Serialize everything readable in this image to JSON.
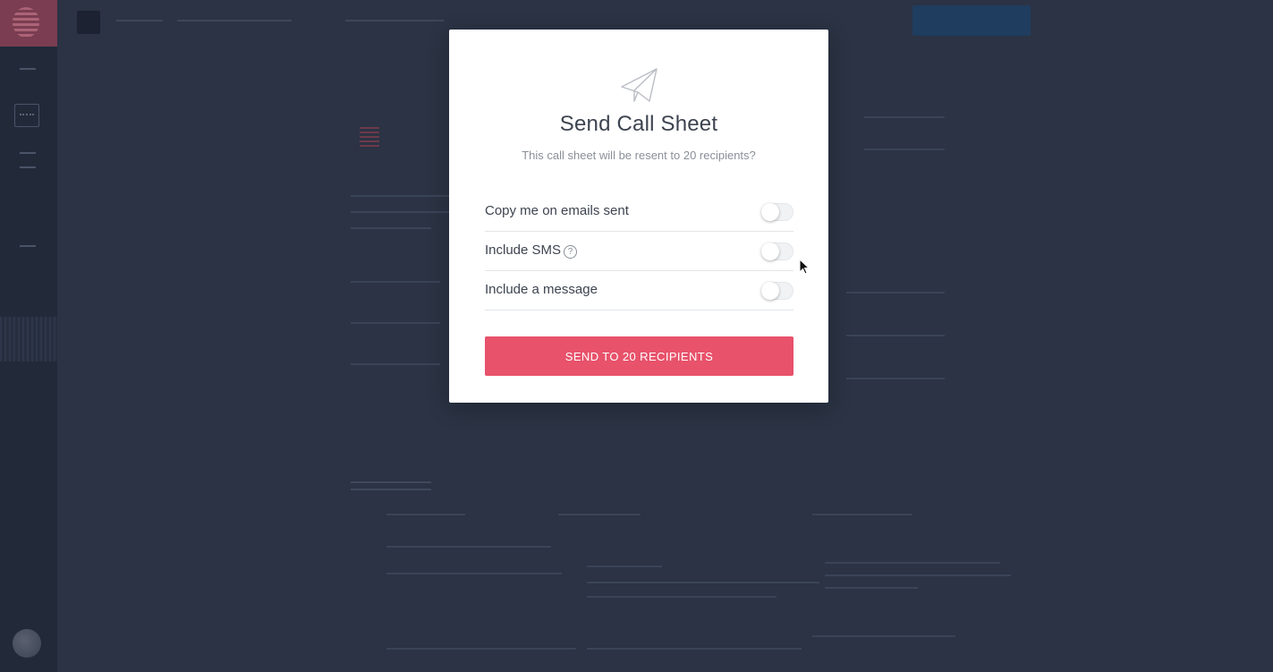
{
  "modal": {
    "icon": "paper-plane-icon",
    "title": "Send Call Sheet",
    "subtitle": "This call sheet will be resent to 20 recipients?",
    "options": [
      {
        "label": "Copy me on emails sent",
        "enabled": false
      },
      {
        "label": "Include SMS",
        "enabled": false,
        "help_icon": "question-circle-icon",
        "help_text": "?"
      },
      {
        "label": "Include a message",
        "enabled": false
      }
    ],
    "send_button_label": "SEND TO 20 RECIPIENTS"
  },
  "colors": {
    "accent": "#e8526b",
    "overlay": "#2b3344",
    "sidebar": "#222a39",
    "text_dark": "#3d4450",
    "text_muted": "#8a8f98"
  },
  "cursor_icon": "mouse-pointer-icon"
}
